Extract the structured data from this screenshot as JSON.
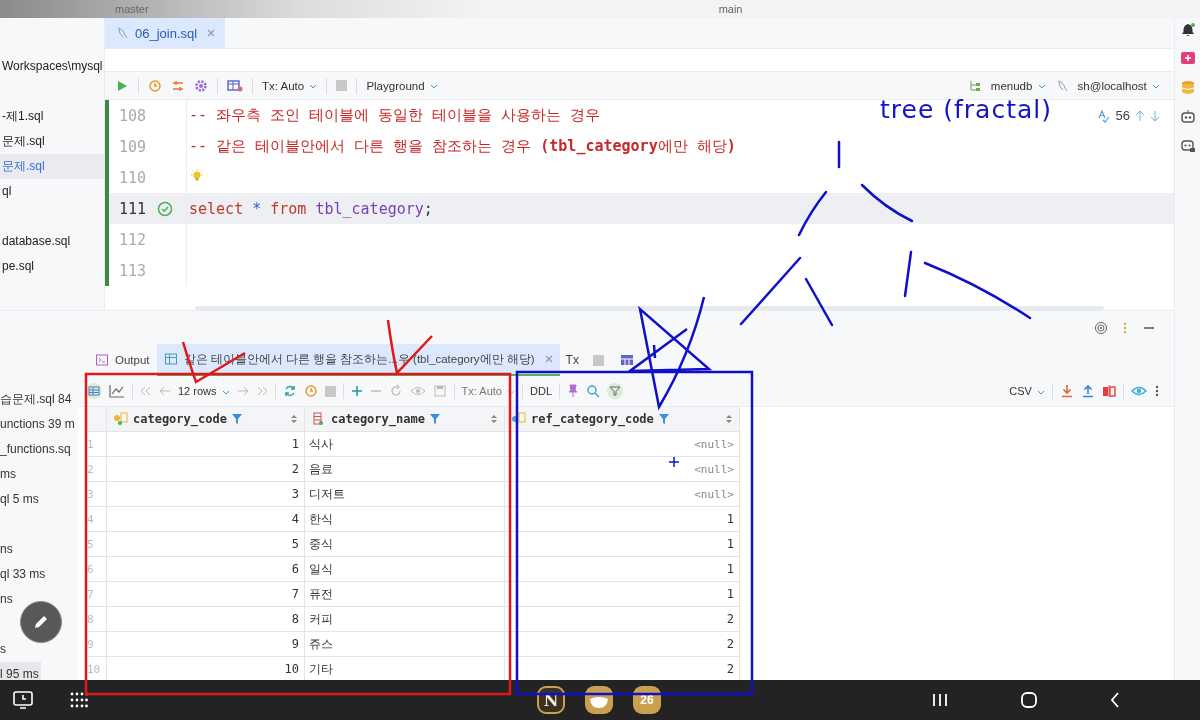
{
  "top_bar": {
    "project": "master",
    "branch": "main"
  },
  "sidebar": {
    "project_items": [
      {
        "label": "Workspaces\\mysql",
        "selected": false
      },
      {
        "label": "-제1.sql",
        "selected": false
      },
      {
        "label": "문제.sql",
        "selected": false
      },
      {
        "label": "문제.sql",
        "selected": true
      },
      {
        "label": "ql",
        "selected": false
      },
      {
        "label": "database.sql",
        "selected": false
      },
      {
        "label": "pe.sql",
        "selected": false
      }
    ],
    "service_items": [
      {
        "label": "습문제.sql  84",
        "selected": false
      },
      {
        "label": "unctions  39 m",
        "selected": false
      },
      {
        "label": "_functions.sq",
        "selected": false
      },
      {
        "label": "ms",
        "selected": false
      },
      {
        "label": "ql  5 ms",
        "selected": false
      },
      {
        "label": "ns",
        "selected": false
      },
      {
        "label": "ql  33 ms",
        "selected": false
      },
      {
        "label": "ns",
        "selected": false
      },
      {
        "label": "s",
        "selected": false
      },
      {
        "label": "l  95 ms",
        "selected": true
      }
    ]
  },
  "editor": {
    "tabs": [
      {
        "label": "06_join.sql",
        "selected": true
      }
    ],
    "toolbar": {
      "tx_mode": "Tx: Auto",
      "session": "Playground",
      "schema": "menudb",
      "datasource": "sh@localhost"
    },
    "inspection_count": "56",
    "lines": [
      {
        "number": "108",
        "kind": "comment",
        "text": "-- 좌우측 조인 테이블에 동일한 테이블을 사용하는 경우",
        "current": false,
        "executed": false
      },
      {
        "number": "109",
        "kind": "comment",
        "text": "-- 같은 테이블안에서 다른 행을 참조하는 경우 **(tbl_category**에만 해당**)**",
        "current": false,
        "executed": false
      },
      {
        "number": "110",
        "kind": "hint",
        "current": false,
        "executed": false
      },
      {
        "number": "111",
        "kind": "code",
        "current": true,
        "executed": true,
        "tokens": [
          {
            "kind": "keyword",
            "text": "select"
          },
          {
            "kind": "operator",
            "text": "*"
          },
          {
            "kind": "keyword",
            "text": "from"
          },
          {
            "kind": "table",
            "text": "tbl_category"
          },
          {
            "kind": "punct",
            "text": ";"
          }
        ]
      },
      {
        "number": "112",
        "kind": "blank",
        "current": false,
        "executed": false
      },
      {
        "number": "113",
        "kind": "blank",
        "current": false,
        "executed": false
      }
    ]
  },
  "results": {
    "tabs": [
      {
        "label": "Output",
        "kind": "output",
        "selected": false
      },
      {
        "label": "같은 테이블안에서 다른 행을 참조하는...우 (tbl_category에만 해당)",
        "kind": "result",
        "selected": true
      }
    ],
    "tx_label": "Tx",
    "toolbar": {
      "row_count": "12 rows",
      "tx_mode": "Tx: Auto",
      "ddl": "DDL",
      "export_format": "CSV"
    },
    "columns": [
      {
        "name": "category_code",
        "kind": "primary_key"
      },
      {
        "name": "category_name",
        "kind": "column"
      },
      {
        "name": "ref_category_code",
        "kind": "foreign_key"
      }
    ],
    "rows": [
      {
        "number": "1",
        "code": "1",
        "name": "식사",
        "ref": "<null>",
        "ref_null": true
      },
      {
        "number": "2",
        "code": "2",
        "name": "음료",
        "ref": "<null>",
        "ref_null": true
      },
      {
        "number": "3",
        "code": "3",
        "name": "디저트",
        "ref": "<null>",
        "ref_null": true
      },
      {
        "number": "4",
        "code": "4",
        "name": "한식",
        "ref": "1",
        "ref_null": false
      },
      {
        "number": "5",
        "code": "5",
        "name": "중식",
        "ref": "1",
        "ref_null": false
      },
      {
        "number": "6",
        "code": "6",
        "name": "일식",
        "ref": "1",
        "ref_null": false
      },
      {
        "number": "7",
        "code": "7",
        "name": "퓨전",
        "ref": "1",
        "ref_null": false
      },
      {
        "number": "8",
        "code": "8",
        "name": "커피",
        "ref": "2",
        "ref_null": false
      },
      {
        "number": "9",
        "code": "9",
        "name": "쥬스",
        "ref": "2",
        "ref_null": false
      },
      {
        "number": "10",
        "code": "10",
        "name": "기타",
        "ref": "2",
        "ref_null": false
      }
    ]
  },
  "annotation_text": "tree (fractal)",
  "dock_apps": [
    {
      "kind": "notion",
      "glyph": "N"
    },
    {
      "kind": "bowl"
    },
    {
      "kind": "calendar",
      "glyph": "26"
    }
  ]
}
